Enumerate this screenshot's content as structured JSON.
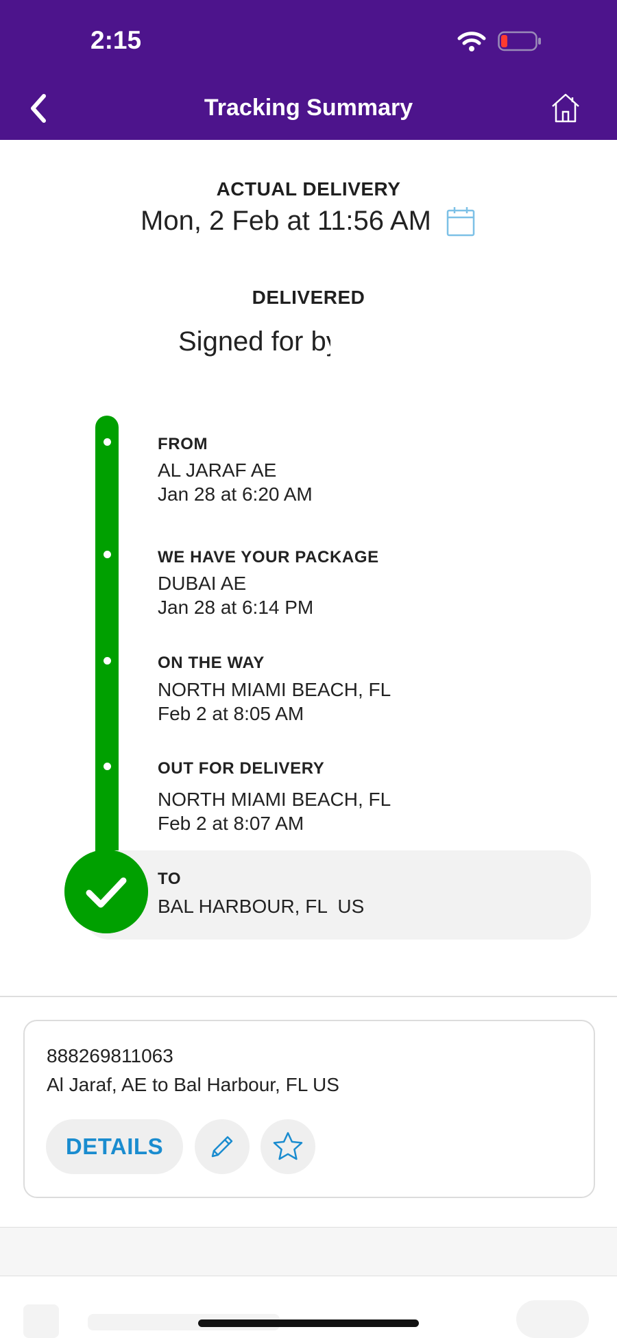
{
  "status_bar": {
    "time": "2:15"
  },
  "nav": {
    "title": "Tracking Summary"
  },
  "delivery": {
    "actual_label": "ACTUAL DELIVERY",
    "actual_date": "Mon, 2 Feb at 11:56 AM",
    "status": "DELIVERED",
    "signed_for": "Signed for by:"
  },
  "timeline": [
    {
      "label": "FROM",
      "location": "AL JARAF AE",
      "time": "Jan 28 at 6:20 AM"
    },
    {
      "label": "WE HAVE YOUR PACKAGE",
      "location": "DUBAI AE",
      "time": "Jan 28 at 6:14 PM"
    },
    {
      "label": "ON THE WAY",
      "location": "NORTH MIAMI BEACH, FL",
      "time": "Feb 2 at 8:05 AM"
    },
    {
      "label": "OUT FOR DELIVERY",
      "location": "NORTH MIAMI BEACH, FL",
      "time": "Feb 2 at 8:07 AM"
    },
    {
      "label": "TO",
      "location": "BAL HARBOUR, FL  US"
    }
  ],
  "shipment": {
    "tracking_number": "888269811063",
    "route": "Al Jaraf, AE to Bal Harbour, FL US",
    "details_label": "DETAILS"
  },
  "icons": {
    "back": "chevron-left-icon",
    "home": "home-icon",
    "calendar": "calendar-icon",
    "edit": "pencil-icon",
    "favorite": "star-icon",
    "delivered": "check-icon",
    "wifi": "wifi-icon",
    "battery": "battery-icon"
  },
  "colors": {
    "header": "#4d148c",
    "timeline": "#00a000",
    "link": "#1a8ccf",
    "battery_low": "#ff3b30"
  }
}
